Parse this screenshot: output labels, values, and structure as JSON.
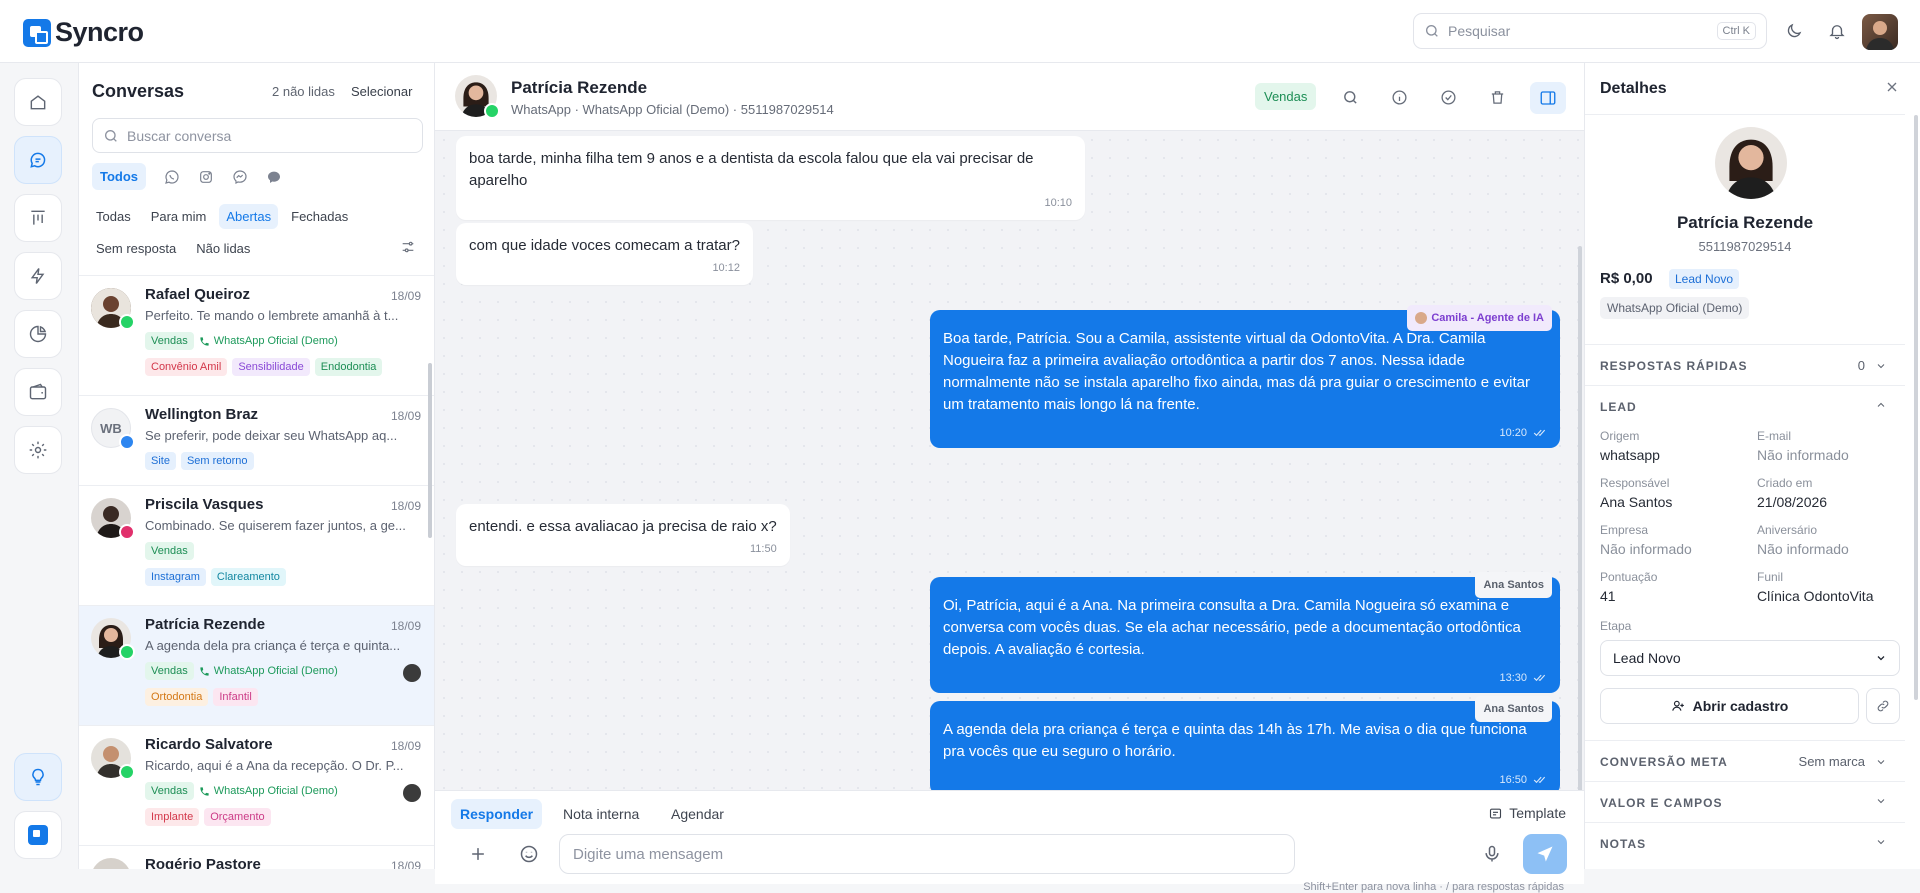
{
  "app": {
    "logo_text": "Syncro"
  },
  "topbar": {
    "search_placeholder": "Pesquisar",
    "search_shortcut": "Ctrl K"
  },
  "colors": {
    "accent": "#1479e8",
    "green": "#1d8e55",
    "whatsapp": "#25d366"
  },
  "convlist": {
    "title": "Conversas",
    "unread": "2 não lidas",
    "select": "Selecionar",
    "search_placeholder": "Buscar conversa",
    "channel_all": "Todos",
    "filters1": [
      "Todas",
      "Para mim",
      "Abertas",
      "Fechadas"
    ],
    "filters2": [
      "Sem resposta",
      "Não lidas"
    ],
    "items": [
      {
        "name": "Rafael Queiroz",
        "date": "18/09",
        "preview": "Perfeito. Te mando o lembrete amanhã à t...",
        "tag1": "Vendas",
        "wa": "WhatsApp Oficial (Demo)",
        "tags": [
          "Convênio Amil",
          "Sensibilidade",
          "Endodontia"
        ]
      },
      {
        "name": "Wellington Braz",
        "initials": "WB",
        "date": "18/09",
        "preview": "Se preferir, pode deixar seu WhatsApp aq...",
        "tags": [
          "Site",
          "Sem retorno"
        ]
      },
      {
        "name": "Priscila Vasques",
        "date": "18/09",
        "preview": "Combinado. Se quiserem fazer juntos, a ge...",
        "tag1": "Vendas",
        "tags": [
          "Instagram",
          "Clareamento"
        ]
      },
      {
        "name": "Patrícia Rezende",
        "date": "18/09",
        "preview": "A agenda dela pra criança é terça e quinta...",
        "tag1": "Vendas",
        "wa": "WhatsApp Oficial (Demo)",
        "tags": [
          "Ortodontia",
          "Infantil"
        ]
      },
      {
        "name": "Ricardo Salvatore",
        "date": "18/09",
        "preview": "Ricardo, aqui é a Ana da recepção. O Dr. P...",
        "tag1": "Vendas",
        "wa": "WhatsApp Oficial (Demo)",
        "tags": [
          "Implante",
          "Orçamento"
        ]
      },
      {
        "name": "Rogério Pastore",
        "date": "18/09"
      }
    ]
  },
  "chat": {
    "name": "Patrícia Rezende",
    "sub": "WhatsApp · WhatsApp Oficial (Demo) · 5511987029514",
    "badge": "Vendas",
    "messages": [
      {
        "text": "boa tarde, minha filha tem 9 anos e a dentista da escola falou que ela vai precisar de aparelho",
        "time": "10:10"
      },
      {
        "text": "com que idade voces comecam a tratar?",
        "time": "10:12"
      },
      {
        "sender": "Camila - Agente de IA",
        "text": "Boa tarde, Patrícia. Sou a Camila, assistente virtual da OdontoVita. A Dra. Camila Nogueira faz a primeira avaliação ortodôntica a partir dos 7 anos. Nessa idade normalmente não se instala aparelho fixo ainda, mas dá pra guiar o crescimento e evitar um tratamento mais longo lá na frente.",
        "time": "10:20"
      },
      {
        "text": "entendi. e essa avaliacao ja precisa de raio x?",
        "time": "11:50"
      },
      {
        "sender": "Ana Santos",
        "text": "Oi, Patrícia, aqui é a Ana. Na primeira consulta a Dra. Camila Nogueira só examina e conversa com vocês duas. Se ela achar necessário, pede a documentação ortodôntica depois. A avaliação é cortesia.",
        "time": "13:30"
      },
      {
        "sender": "Ana Santos",
        "text": "A agenda dela pra criança é terça e quinta das 14h às 17h. Me avisa o dia que funciona pra vocês que eu seguro o horário.",
        "time": "16:50"
      }
    ],
    "composer": {
      "tabs": [
        "Responder",
        "Nota interna",
        "Agendar"
      ],
      "template": "Template",
      "placeholder": "Digite uma mensagem",
      "hint": "Shift+Enter para nova linha · / para respostas rápidas"
    }
  },
  "details": {
    "title": "Detalhes",
    "name": "Patrícia Rezende",
    "phone": "5511987029514",
    "value": "R$ 0,00",
    "lead_badge": "Lead Novo",
    "channel": "WhatsApp Oficial (Demo)",
    "quick_replies": {
      "label": "RESPOSTAS RÁPIDAS",
      "count": "0"
    },
    "lead": {
      "label": "LEAD",
      "fields": [
        {
          "label": "Origem",
          "value": "whatsapp"
        },
        {
          "label": "E-mail",
          "value": "Não informado"
        },
        {
          "label": "Responsável",
          "value": "Ana Santos"
        },
        {
          "label": "Criado em",
          "value": "21/08/2026"
        },
        {
          "label": "Empresa",
          "value": "Não informado"
        },
        {
          "label": "Aniversário",
          "value": "Não informado"
        },
        {
          "label": "Pontuação",
          "value": "41"
        },
        {
          "label": "Funil",
          "value": "Clínica OdontoVita"
        }
      ],
      "etapa_label": "Etapa",
      "etapa_value": "Lead Novo",
      "open_button": "Abrir cadastro"
    },
    "meta": {
      "label": "CONVERSÃO META",
      "value": "Sem marca"
    },
    "valor": {
      "label": "VALOR E CAMPOS"
    },
    "notas": {
      "label": "NOTAS"
    }
  }
}
